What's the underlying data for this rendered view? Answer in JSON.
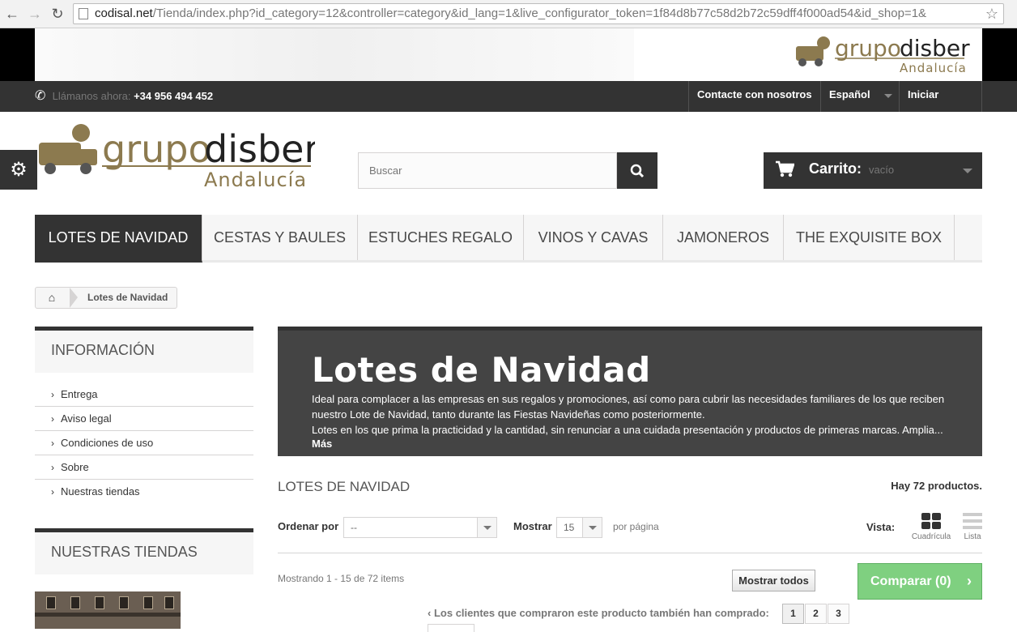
{
  "browser": {
    "url_host": "codisal.net",
    "url_path": "/Tienda/index.php?id_category=12&controller=category&id_lang=1&live_configurator_token=1f84d8b77c58d2b72c59dff4f000ad54&id_shop=1&"
  },
  "brand": {
    "logo_part1": "grupo",
    "logo_part2": "disber",
    "logo_sub": "Andalucía"
  },
  "topbar": {
    "call_label": "Llámanos ahora:",
    "phone": "+34 956 494 452",
    "contact": "Contacte con nosotros",
    "language": "Español",
    "login": "Iniciar sesión"
  },
  "search": {
    "placeholder": "Buscar"
  },
  "cart": {
    "label": "Carrito:",
    "status": "vacío"
  },
  "menu": [
    {
      "label": "LOTES DE NAVIDAD",
      "active": true
    },
    {
      "label": "CESTAS Y BAULES"
    },
    {
      "label": "ESTUCHES REGALO"
    },
    {
      "label": "VINOS Y CAVAS"
    },
    {
      "label": "JAMONEROS"
    },
    {
      "label": "THE EXQUISITE BOX"
    }
  ],
  "breadcrumb": {
    "current": "Lotes de Navidad"
  },
  "sidebar": {
    "info_title": "INFORMACIÓN",
    "info_items": [
      "Entrega",
      "Aviso legal",
      "Condiciones de uso",
      "Sobre",
      "Nuestras tiendas"
    ],
    "stores_title": "NUESTRAS TIENDAS"
  },
  "category": {
    "title": "Lotes de Navidad",
    "desc_line1": "Ideal para complacer a las empresas en sus regalos y promociones, así como para cubrir las necesidades familiares de los que reciben nuestro Lote de Navidad, tanto durante las Fiestas Navideñas como posteriormente.",
    "desc_line2": "Lotes en los que prima la practicidad y la cantidad, sin renunciar a una cuidada presentación y productos de primeras marcas. Amplia...",
    "more": "Más"
  },
  "listing": {
    "heading": "LOTES DE NAVIDAD",
    "count": "Hay 72 productos.",
    "sort_label": "Ordenar por",
    "sort_value": "--",
    "show_label": "Mostrar",
    "show_value": "15",
    "per_page": "por página",
    "view_label": "Vista:",
    "view_grid": "Cuadrícula",
    "view_list": "Lista",
    "showing": "Mostrando 1 - 15 de 72 items",
    "show_all": "Mostrar todos",
    "compare": "Comparar (0)",
    "also_bought": "Los clientes que compraron este producto también han comprado:",
    "pages": [
      "1",
      "2",
      "3"
    ]
  }
}
